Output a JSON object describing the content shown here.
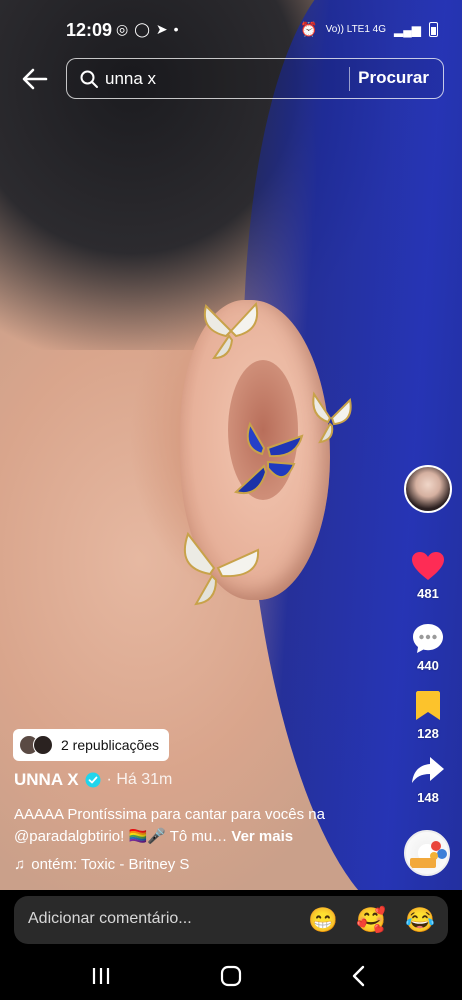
{
  "status_bar": {
    "time": "12:09",
    "left_icons": [
      "instagram-icon",
      "whatsapp-icon",
      "telegram-icon",
      "dot-icon"
    ],
    "right_text": "Vo)) LTE1 4G"
  },
  "search": {
    "query": "unna x",
    "button_label": "Procurar"
  },
  "rail": {
    "likes": "481",
    "comments": "440",
    "saves": "128",
    "shares": "148"
  },
  "post": {
    "reposts_label": "2 republicações",
    "author": "UNNA X",
    "time": "· Há 31m",
    "caption": "AAAAA Prontíssima para cantar para vocês na @paradalgbtirio! 🏳️‍🌈🎤 Tô mu…",
    "more_label": "Ver mais",
    "music": "ontém: Toxic - Britney S"
  },
  "comment_bar": {
    "placeholder": "Adicionar comentário...",
    "emojis": [
      "😁",
      "🥰",
      "😂"
    ]
  },
  "colors": {
    "like": "#fe2c55",
    "save": "#fcc32c",
    "verified": "#20d5ec"
  }
}
